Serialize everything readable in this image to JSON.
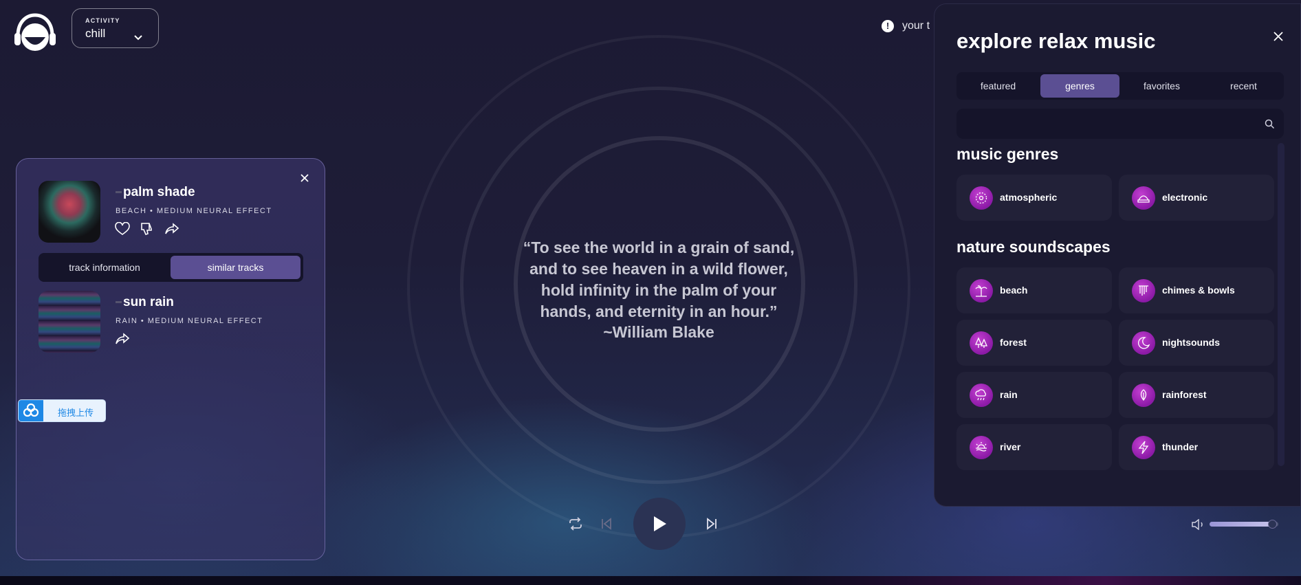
{
  "header": {
    "activity_caption": "ACTIVITY",
    "activity_value": "chill",
    "notice_text": "your t"
  },
  "quote": {
    "line1": "“To see the world in a grain of sand,",
    "line2": "and to see heaven in a wild flower,",
    "line3": "hold infinity in the palm of your",
    "line4": "hands, and eternity in an hour.”",
    "author": "~William Blake"
  },
  "player": {
    "volume_level": 0.92
  },
  "track_panel": {
    "current": {
      "title": "palm shade",
      "subtitle": "BEACH • MEDIUM NEURAL EFFECT"
    },
    "tabs": [
      "track information",
      "similar tracks"
    ],
    "active_tab": "similar tracks",
    "similar": [
      {
        "title": "sun rain",
        "subtitle": "RAIN • MEDIUM NEURAL EFFECT"
      }
    ],
    "upload_label": "拖拽上传"
  },
  "explore": {
    "title": "explore relax music",
    "tabs": [
      "featured",
      "genres",
      "favorites",
      "recent"
    ],
    "active_tab": "genres",
    "search_placeholder": "",
    "sections": [
      {
        "heading": "music genres",
        "items": [
          "atmospheric",
          "electronic"
        ]
      },
      {
        "heading": "nature soundscapes",
        "items": [
          "beach",
          "chimes & bowls",
          "forest",
          "nightsounds",
          "rain",
          "rainforest",
          "river",
          "thunder"
        ]
      }
    ]
  },
  "colors": {
    "accent": "#5b4f93",
    "badge": "#a52bbd",
    "panel_bg": "#1b1a31",
    "background": "#1e1d38"
  },
  "icons": {
    "logo": "headphones-face-logo",
    "notice": "alert-icon",
    "like": "heart-icon",
    "dislike": "thumbs-down-icon",
    "share": "share-icon",
    "close": "close-icon",
    "search": "search-icon",
    "repeat": "repeat-icon",
    "prev": "skip-back-icon",
    "play": "play-icon",
    "next": "skip-forward-icon",
    "volume": "volume-icon"
  }
}
